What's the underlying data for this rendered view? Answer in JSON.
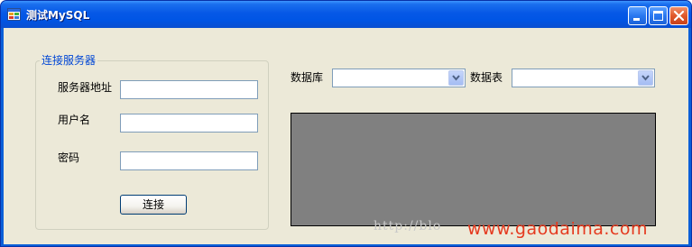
{
  "window": {
    "title": "测试MySQL"
  },
  "connection_group": {
    "title": "连接服务器",
    "server_label": "服务器地址",
    "server_value": "",
    "user_label": "用户名",
    "user_value": "",
    "password_label": "密码",
    "password_value": "",
    "connect_label": "连接"
  },
  "selectors": {
    "database_label": "数据库",
    "database_value": "",
    "table_label": "数据表",
    "table_value": ""
  },
  "watermark": {
    "url_text": "http://blo",
    "site_text": "www.gaodaima.com"
  },
  "colors": {
    "titlebar": "#0055e5",
    "client_bg": "#ece9d8",
    "group_title": "#0046d5",
    "grid_bg": "#808080",
    "watermark_site": "#e53a1f"
  },
  "icons": {
    "app": "form-app-icon",
    "minimize": "minimize-icon",
    "maximize": "maximize-icon",
    "close": "close-icon",
    "dropdown": "chevron-down-icon"
  }
}
